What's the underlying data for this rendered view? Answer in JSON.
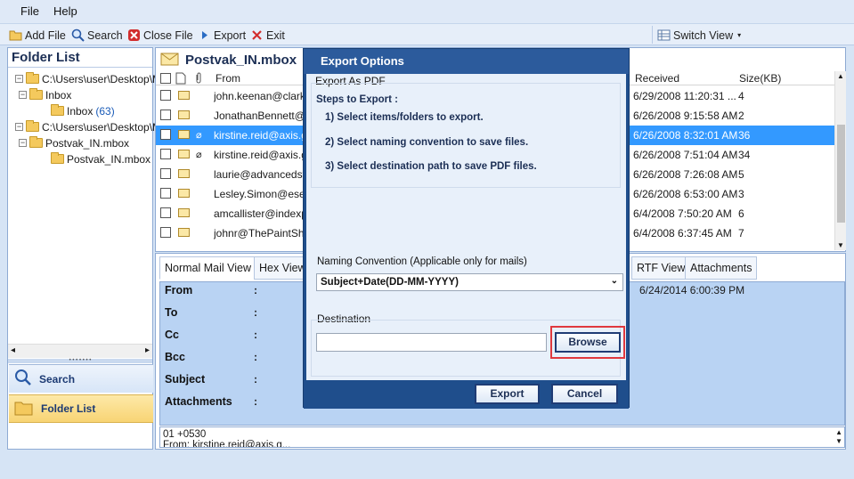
{
  "menu": {
    "file": "File",
    "help": "Help"
  },
  "toolbar": {
    "add_file": "Add File",
    "search": "Search",
    "close_file": "Close File",
    "export": "Export",
    "exit": "Exit",
    "switch_view": "Switch View"
  },
  "folder_list": {
    "title": "Folder List",
    "tree": [
      {
        "label": "C:\\Users\\user\\Desktop\\M"
      },
      {
        "label": "Inbox"
      },
      {
        "label": "Inbox",
        "count": "(63)"
      },
      {
        "label": "C:\\Users\\user\\Desktop\\M"
      },
      {
        "label": "Postvak_IN.mbox"
      },
      {
        "label": "Postvak_IN.mbox"
      }
    ],
    "nav_search": "Search",
    "nav_folder": "Folder List"
  },
  "mail_list": {
    "title": "Postvak_IN.mbox",
    "columns": {
      "from": "From",
      "received": "Received",
      "size": "Size(KB)"
    },
    "rows": [
      {
        "from": "john.keenan@clark",
        "received": "6/29/2008 11:20:31 ...",
        "size": "4",
        "checked": false,
        "attach": false
      },
      {
        "from": "JonathanBennett@",
        "received": "6/26/2008 9:15:58 AM",
        "size": "2",
        "checked": false,
        "attach": false
      },
      {
        "from": "kirstine.reid@axis.g",
        "received": "6/26/2008 8:32:01 AM",
        "size": "36",
        "checked": true,
        "attach": true
      },
      {
        "from": "kirstine.reid@axis.g",
        "received": "6/26/2008 7:51:04 AM",
        "size": "34",
        "checked": false,
        "attach": true
      },
      {
        "from": "laurie@advancedst.",
        "received": "6/26/2008 7:26:08 AM",
        "size": "5",
        "checked": false,
        "attach": false
      },
      {
        "from": "Lesley.Simon@ese-s",
        "received": "6/26/2008 6:53:00 AM",
        "size": "3",
        "checked": false,
        "attach": false
      },
      {
        "from": "amcallister@indexp",
        "received": "6/4/2008 7:50:20 AM",
        "size": "6",
        "checked": false,
        "attach": false
      },
      {
        "from": "johnr@ThePaintShe",
        "received": "6/4/2008 6:37:45 AM",
        "size": "7",
        "checked": false,
        "attach": false
      }
    ]
  },
  "preview": {
    "tabs": {
      "normal": "Normal Mail View",
      "hex": "Hex View",
      "rtf": "RTF View",
      "attachments": "Attachments"
    },
    "labels": {
      "from": "From",
      "to": "To",
      "cc": "Cc",
      "bcc": "Bcc",
      "subject": "Subject",
      "attachments": "Attachments"
    },
    "colon": ":",
    "date": "6/24/2014 6:00:39 PM",
    "text_line1": "01 +0530",
    "text_line2": "From: kirstine.reid@axis.g..."
  },
  "dialog": {
    "title": "Export Options",
    "group_title": "Export As PDF",
    "steps_heading": "Steps to Export :",
    "steps": [
      "1) Select items/folders to export.",
      "2) Select naming convention to save files.",
      "3) Select destination path to save PDF files."
    ],
    "naming_label": "Naming Convention (Applicable only for mails)",
    "naming_value": "Subject+Date(DD-MM-YYYY)",
    "destination_label": "Destination",
    "destination_value": "",
    "browse": "Browse",
    "export": "Export",
    "cancel": "Cancel"
  },
  "colors": {
    "selection": "#3399ff",
    "dialog_frame": "#1f4e8c",
    "highlight_box": "#e0393e"
  }
}
